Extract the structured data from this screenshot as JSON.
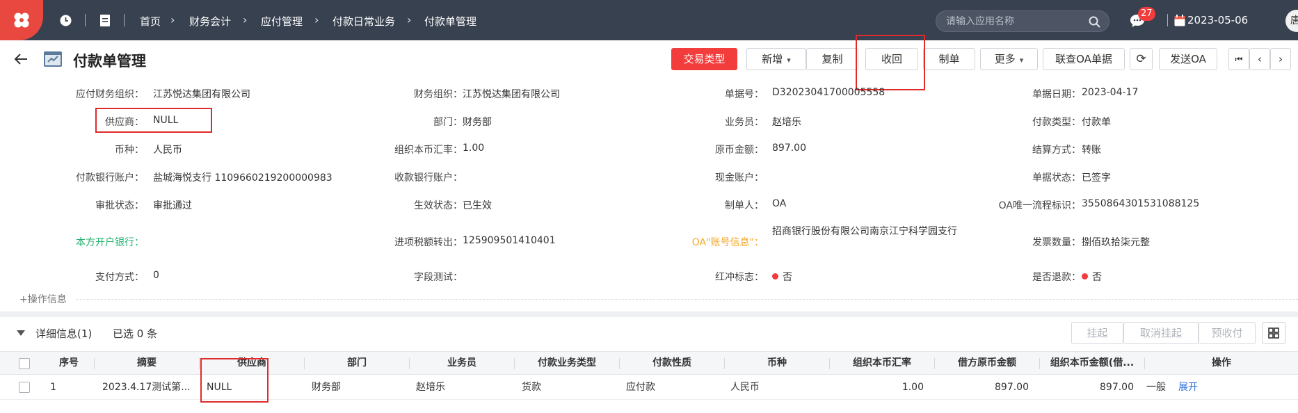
{
  "topbar": {
    "breadcrumb": [
      "首页",
      "财务会计",
      "应付管理",
      "付款日常业务",
      "付款单管理"
    ],
    "search_placeholder": "请输入应用名称",
    "badge_count": "27",
    "date": "2023-05-06",
    "avatar_text": "唐"
  },
  "page": {
    "title": "付款单管理",
    "buttons": {
      "trade_type": "交易类型",
      "add": "新增",
      "copy": "复制",
      "recall": "收回",
      "make": "制单",
      "more": "更多",
      "oa_query": "联查OA单据",
      "send_oa": "发送OA"
    },
    "pager": {
      "first": "⏮",
      "prev": "‹",
      "next": "›"
    }
  },
  "form": {
    "fields": [
      {
        "label": "应付财务组织：",
        "value": "江苏悦达集团有限公司"
      },
      {
        "label": "财务组织：",
        "value": "江苏悦达集团有限公司"
      },
      {
        "label": "单据号：",
        "value": "D32023041700005558"
      },
      {
        "label": "单据日期：",
        "value": "2023-04-17"
      },
      {
        "label": "供应商：",
        "value": "NULL"
      },
      {
        "label": "部门：",
        "value": "财务部"
      },
      {
        "label": "业务员：",
        "value": "赵培乐"
      },
      {
        "label": "付款类型：",
        "value": "付款单"
      },
      {
        "label": "币种：",
        "value": "人民币"
      },
      {
        "label": "组织本币汇率：",
        "value": "1.00"
      },
      {
        "label": "原币金额：",
        "value": "897.00"
      },
      {
        "label": "结算方式：",
        "value": "转账"
      },
      {
        "label": "付款银行账户：",
        "value": "盐城海悦支行 1109660219200000983"
      },
      {
        "label": "收款银行账户：",
        "value": ""
      },
      {
        "label": "现金账户：",
        "value": ""
      },
      {
        "label": "单据状态：",
        "value": "已签字"
      },
      {
        "label": "审批状态：",
        "value": "审批通过"
      },
      {
        "label": "生效状态：",
        "value": "已生效"
      },
      {
        "label": "制单人：",
        "value": "OA"
      },
      {
        "label": "OA唯一流程标识：",
        "value": "3550864301531088125"
      },
      {
        "label": "本方开户银行：",
        "value": ""
      },
      {
        "label": "进项税额转出：",
        "value": "125909501410401"
      },
      {
        "label": "OA\"账号信息\"：",
        "value": "招商银行股份有限公司南京江宁科学园支行"
      },
      {
        "label": "发票数量：",
        "value": "捌佰玖拾柒元整"
      },
      {
        "label": "支付方式：",
        "value": "0"
      },
      {
        "label": "字段测试：",
        "value": ""
      },
      {
        "label": "红冲标志：",
        "value": "否"
      },
      {
        "label": "是否退款：",
        "value": "否"
      }
    ],
    "op_info": "+操作信息"
  },
  "detail": {
    "title": "详细信息(1)",
    "selected": "已选 0 条",
    "buttons": {
      "hang": "挂起",
      "unhang": "取消挂起",
      "prepay": "预收付"
    },
    "columns": [
      "序号",
      "摘要",
      "供应商",
      "部门",
      "业务员",
      "付款业务类型",
      "付款性质",
      "币种",
      "组织本币汇率",
      "借方原币金额",
      "组织本币金额(借...",
      "操作"
    ],
    "rows": [
      {
        "no": "1",
        "summary": "2023.4.17测试第...",
        "supplier": "NULL",
        "dept": "财务部",
        "staff": "赵培乐",
        "biz_type": "货款",
        "nature": "应付款",
        "currency": "人民币",
        "rate": "1.00",
        "debit_orig": "897.00",
        "debit_org": "897.00",
        "op_text": "一般",
        "op_link": "展开"
      }
    ]
  },
  "colors": {
    "topbar": "#384150",
    "accent": "#f33c3c",
    "highlight": "#e02b2b",
    "link": "#2e73d6",
    "green_label": "#20b26b",
    "orange_label": "#f5a623"
  }
}
